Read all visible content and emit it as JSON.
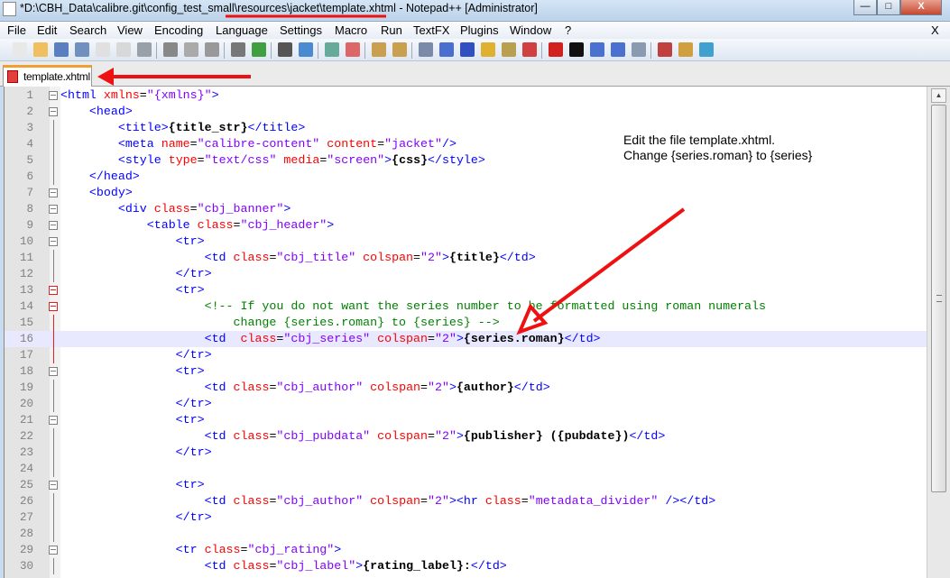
{
  "window": {
    "title": "*D:\\CBH_Data\\calibre.git\\config_test_small\\resources\\jacket\\template.xhtml - Notepad++ [Administrator]",
    "minimize": "—",
    "maximize": "□",
    "close": "X"
  },
  "menu": [
    "File",
    "Edit",
    "Search",
    "View",
    "Encoding",
    "Language",
    "Settings",
    "Macro",
    "Run",
    "TextFX",
    "Plugins",
    "Window",
    "?"
  ],
  "menu_close": "X",
  "toolbar_icons": [
    "new-file",
    "open-file",
    "save",
    "save-all",
    "close",
    "close-all",
    "print",
    "cut",
    "copy",
    "paste",
    "undo",
    "redo",
    "find",
    "replace",
    "zoom-in",
    "zoom-out",
    "sync-vertical",
    "sync-horizontal",
    "word-wrap",
    "show-all-chars",
    "indent-guide",
    "user-defined-lang",
    "map",
    "function-list",
    "record-macro",
    "stop-record",
    "play-macro",
    "run-macro-multiple",
    "save-macro",
    "spell-check",
    "spell-check-folder",
    "auto-spell-check"
  ],
  "tab": {
    "label": "template.xhtml"
  },
  "annotation": {
    "line1": "Edit the file template.xhtml.",
    "line2": "Change {series.roman} to {series}"
  },
  "colors": {
    "annotation_arrow": "#ee1111",
    "tag": "#0000ff",
    "attr": "#ff0000",
    "value": "#8000ff",
    "comment": "#008000"
  },
  "editor": {
    "current_line": 16,
    "lines": [
      {
        "n": "1",
        "t": [
          [
            "tag",
            "<html"
          ],
          [
            "attr",
            " xmlns"
          ],
          [
            "eq",
            "="
          ],
          [
            "val",
            "\"{xmlns}\""
          ],
          [
            "tag",
            ">"
          ]
        ]
      },
      {
        "n": "2",
        "t": [
          [
            "plain",
            "    "
          ],
          [
            "tag",
            "<head>"
          ]
        ]
      },
      {
        "n": "3",
        "t": [
          [
            "plain",
            "        "
          ],
          [
            "tag",
            "<title>"
          ],
          [
            "text",
            "{title_str}"
          ],
          [
            "tag",
            "</title>"
          ]
        ]
      },
      {
        "n": "4",
        "t": [
          [
            "plain",
            "        "
          ],
          [
            "tag",
            "<meta"
          ],
          [
            "attr",
            " name"
          ],
          [
            "eq",
            "="
          ],
          [
            "val",
            "\"calibre-content\""
          ],
          [
            "attr",
            " content"
          ],
          [
            "eq",
            "="
          ],
          [
            "val",
            "\"jacket\""
          ],
          [
            "tag",
            "/>"
          ]
        ]
      },
      {
        "n": "5",
        "t": [
          [
            "plain",
            "        "
          ],
          [
            "tag",
            "<style"
          ],
          [
            "attr",
            " type"
          ],
          [
            "eq",
            "="
          ],
          [
            "val",
            "\"text/css\""
          ],
          [
            "attr",
            " media"
          ],
          [
            "eq",
            "="
          ],
          [
            "val",
            "\"screen\""
          ],
          [
            "tag",
            ">"
          ],
          [
            "text",
            "{css}"
          ],
          [
            "tag",
            "</style>"
          ]
        ]
      },
      {
        "n": "6",
        "t": [
          [
            "plain",
            "    "
          ],
          [
            "tag",
            "</head>"
          ]
        ]
      },
      {
        "n": "7",
        "t": [
          [
            "plain",
            "    "
          ],
          [
            "tag",
            "<body>"
          ]
        ]
      },
      {
        "n": "8",
        "t": [
          [
            "plain",
            "        "
          ],
          [
            "tag",
            "<div"
          ],
          [
            "attr",
            " class"
          ],
          [
            "eq",
            "="
          ],
          [
            "val",
            "\"cbj_banner\""
          ],
          [
            "tag",
            ">"
          ]
        ]
      },
      {
        "n": "9",
        "t": [
          [
            "plain",
            "            "
          ],
          [
            "tag",
            "<table"
          ],
          [
            "attr",
            " class"
          ],
          [
            "eq",
            "="
          ],
          [
            "val",
            "\"cbj_header\""
          ],
          [
            "tag",
            ">"
          ]
        ]
      },
      {
        "n": "10",
        "t": [
          [
            "plain",
            "                "
          ],
          [
            "tag",
            "<tr>"
          ]
        ]
      },
      {
        "n": "11",
        "t": [
          [
            "plain",
            "                    "
          ],
          [
            "tag",
            "<td"
          ],
          [
            "attr",
            " class"
          ],
          [
            "eq",
            "="
          ],
          [
            "val",
            "\"cbj_title\""
          ],
          [
            "attr",
            " colspan"
          ],
          [
            "eq",
            "="
          ],
          [
            "val",
            "\"2\""
          ],
          [
            "tag",
            ">"
          ],
          [
            "text",
            "{title}"
          ],
          [
            "tag",
            "</td>"
          ]
        ]
      },
      {
        "n": "12",
        "t": [
          [
            "plain",
            "                "
          ],
          [
            "tag",
            "</tr>"
          ]
        ]
      },
      {
        "n": "13",
        "t": [
          [
            "plain",
            "                "
          ],
          [
            "tag",
            "<tr>"
          ]
        ]
      },
      {
        "n": "14",
        "t": [
          [
            "plain",
            "                    "
          ],
          [
            "com",
            "<!-- If you do not want the series number to be formatted using roman numerals"
          ]
        ]
      },
      {
        "n": "15",
        "t": [
          [
            "com",
            "                        change {series.roman} to {series} -->"
          ]
        ]
      },
      {
        "n": "16",
        "t": [
          [
            "plain",
            "                    "
          ],
          [
            "tag",
            "<td"
          ],
          [
            "attr",
            "  class"
          ],
          [
            "eq",
            "="
          ],
          [
            "val",
            "\"cbj_series\""
          ],
          [
            "attr",
            " colspan"
          ],
          [
            "eq",
            "="
          ],
          [
            "val",
            "\"2\""
          ],
          [
            "tag",
            ">"
          ],
          [
            "text",
            "{series.roman}"
          ],
          [
            "tag",
            "</td>"
          ]
        ]
      },
      {
        "n": "17",
        "t": [
          [
            "plain",
            "                "
          ],
          [
            "tag",
            "</tr>"
          ]
        ]
      },
      {
        "n": "18",
        "t": [
          [
            "plain",
            "                "
          ],
          [
            "tag",
            "<tr>"
          ]
        ]
      },
      {
        "n": "19",
        "t": [
          [
            "plain",
            "                    "
          ],
          [
            "tag",
            "<td"
          ],
          [
            "attr",
            " class"
          ],
          [
            "eq",
            "="
          ],
          [
            "val",
            "\"cbj_author\""
          ],
          [
            "attr",
            " colspan"
          ],
          [
            "eq",
            "="
          ],
          [
            "val",
            "\"2\""
          ],
          [
            "tag",
            ">"
          ],
          [
            "text",
            "{author}"
          ],
          [
            "tag",
            "</td>"
          ]
        ]
      },
      {
        "n": "20",
        "t": [
          [
            "plain",
            "                "
          ],
          [
            "tag",
            "</tr>"
          ]
        ]
      },
      {
        "n": "21",
        "t": [
          [
            "plain",
            "                "
          ],
          [
            "tag",
            "<tr>"
          ]
        ]
      },
      {
        "n": "22",
        "t": [
          [
            "plain",
            "                    "
          ],
          [
            "tag",
            "<td"
          ],
          [
            "attr",
            " class"
          ],
          [
            "eq",
            "="
          ],
          [
            "val",
            "\"cbj_pubdata\""
          ],
          [
            "attr",
            " colspan"
          ],
          [
            "eq",
            "="
          ],
          [
            "val",
            "\"2\""
          ],
          [
            "tag",
            ">"
          ],
          [
            "text",
            "{publisher} ({pubdate})"
          ],
          [
            "tag",
            "</td>"
          ]
        ]
      },
      {
        "n": "23",
        "t": [
          [
            "plain",
            "                "
          ],
          [
            "tag",
            "</tr>"
          ]
        ]
      },
      {
        "n": "24",
        "t": []
      },
      {
        "n": "25",
        "t": [
          [
            "plain",
            "                "
          ],
          [
            "tag",
            "<tr>"
          ]
        ]
      },
      {
        "n": "26",
        "t": [
          [
            "plain",
            "                    "
          ],
          [
            "tag",
            "<td"
          ],
          [
            "attr",
            " class"
          ],
          [
            "eq",
            "="
          ],
          [
            "val",
            "\"cbj_author\""
          ],
          [
            "attr",
            " colspan"
          ],
          [
            "eq",
            "="
          ],
          [
            "val",
            "\"2\""
          ],
          [
            "tag",
            "><hr"
          ],
          [
            "attr",
            " class"
          ],
          [
            "eq",
            "="
          ],
          [
            "val",
            "\"metadata_divider\""
          ],
          [
            "tag",
            " /></td>"
          ]
        ]
      },
      {
        "n": "27",
        "t": [
          [
            "plain",
            "                "
          ],
          [
            "tag",
            "</tr>"
          ]
        ]
      },
      {
        "n": "28",
        "t": []
      },
      {
        "n": "29",
        "t": [
          [
            "plain",
            "                "
          ],
          [
            "tag",
            "<tr"
          ],
          [
            "attr",
            " class"
          ],
          [
            "eq",
            "="
          ],
          [
            "val",
            "\"cbj_rating\""
          ],
          [
            "tag",
            ">"
          ]
        ]
      },
      {
        "n": "30",
        "t": [
          [
            "plain",
            "                    "
          ],
          [
            "tag",
            "<td"
          ],
          [
            "attr",
            " class"
          ],
          [
            "eq",
            "="
          ],
          [
            "val",
            "\"cbj_label\""
          ],
          [
            "tag",
            ">"
          ],
          [
            "text",
            "{rating_label}:"
          ],
          [
            "tag",
            "</td>"
          ]
        ]
      }
    ]
  }
}
